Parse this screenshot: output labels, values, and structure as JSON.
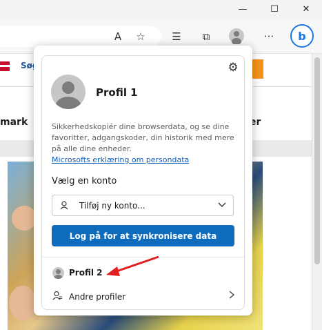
{
  "window": {
    "minimize_icon": "minimize-icon",
    "maximize_icon": "maximize-icon",
    "close_icon": "close-icon",
    "minimize": "—",
    "maximize": "☐",
    "close": "✕"
  },
  "toolbar": {
    "read_aloud": "A",
    "favorite": "☆",
    "favorites": "☰",
    "collections": "⧉",
    "more": "···",
    "bing": "b"
  },
  "page": {
    "search_label": "Søg",
    "left_text": "mark",
    "right_text": "er"
  },
  "profile_panel": {
    "settings_icon": "⚙",
    "profile_name": "Profil 1",
    "description": "Sikkerhedskopiér dine browserdata, og se dine favoritter, adgangskoder, din historik med mere på alle dine enheder.",
    "privacy_link": "Microsofts erklæring om persondata",
    "choose_account_label": "Vælg en konto",
    "account_select_value": "Tilføj ny konto...",
    "sign_in_button": "Log på for at synkronisere data",
    "other_profile_name": "Profil 2",
    "other_profiles_label": "Andre profiler"
  },
  "colors": {
    "accent": "#0f6cbd",
    "link": "#0f5fc2",
    "arrow": "#e02020"
  }
}
